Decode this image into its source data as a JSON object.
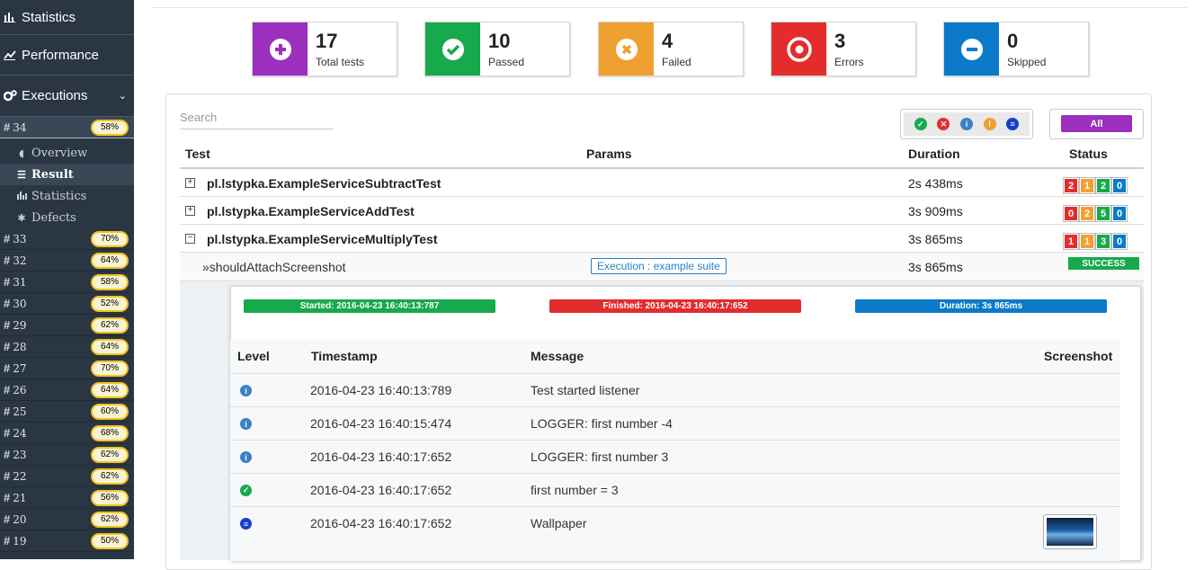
{
  "sidebar": {
    "nav": [
      {
        "label": "Statistics",
        "icon": "bar-chart-icon"
      },
      {
        "label": "Performance",
        "icon": "line-chart-icon"
      },
      {
        "label": "Executions",
        "icon": "gears-icon"
      }
    ],
    "current_run": {
      "hash": "#",
      "num": "34",
      "pct": "58%"
    },
    "sub_items": [
      {
        "label": "Overview",
        "icon": "dashboard-icon"
      },
      {
        "label": "Result",
        "icon": "list-icon"
      },
      {
        "label": "Statistics",
        "icon": "bar-chart-icon"
      },
      {
        "label": "Defects",
        "icon": "bug-icon"
      }
    ],
    "runs": [
      {
        "num": "33",
        "pct": "70%"
      },
      {
        "num": "32",
        "pct": "64%"
      },
      {
        "num": "31",
        "pct": "58%"
      },
      {
        "num": "30",
        "pct": "52%"
      },
      {
        "num": "29",
        "pct": "62%"
      },
      {
        "num": "28",
        "pct": "64%"
      },
      {
        "num": "27",
        "pct": "70%"
      },
      {
        "num": "26",
        "pct": "64%"
      },
      {
        "num": "25",
        "pct": "60%"
      },
      {
        "num": "24",
        "pct": "68%"
      },
      {
        "num": "23",
        "pct": "62%"
      },
      {
        "num": "22",
        "pct": "62%"
      },
      {
        "num": "21",
        "pct": "56%"
      },
      {
        "num": "20",
        "pct": "62%"
      },
      {
        "num": "19",
        "pct": "50%"
      }
    ]
  },
  "stats": [
    {
      "value": "17",
      "label": "Total tests",
      "color": "#9b2fbe",
      "icon": "plus-icon"
    },
    {
      "value": "10",
      "label": "Passed",
      "color": "#17a94b",
      "icon": "check-icon"
    },
    {
      "value": "4",
      "label": "Failed",
      "color": "#f0a030",
      "icon": "times-icon"
    },
    {
      "value": "3",
      "label": "Errors",
      "color": "#e32d2d",
      "icon": "target-icon"
    },
    {
      "value": "0",
      "label": "Skipped",
      "color": "#0b7ac8",
      "icon": "minus-icon"
    }
  ],
  "search": {
    "placeholder": "Search"
  },
  "filter_all_label": "All",
  "table": {
    "headers": {
      "test": "Test",
      "params": "Params",
      "duration": "Duration",
      "status": "Status"
    },
    "rows": [
      {
        "name": "pl.lstypka.ExampleServiceSubtractTest",
        "duration": "2s 438ms",
        "counts": [
          "2",
          "1",
          "2",
          "0"
        ],
        "expand": "+"
      },
      {
        "name": "pl.lstypka.ExampleServiceAddTest",
        "duration": "3s 909ms",
        "counts": [
          "0",
          "2",
          "5",
          "0"
        ],
        "expand": "+"
      },
      {
        "name": "pl.lstypka.ExampleServiceMultiplyTest",
        "duration": "3s 865ms",
        "counts": [
          "1",
          "1",
          "3",
          "0"
        ],
        "expand": "−"
      }
    ],
    "method": {
      "name": "»shouldAttachScreenshot",
      "params": "Execution : example suite",
      "duration": "3s 865ms",
      "status": "SUCCESS"
    }
  },
  "detail": {
    "started": "Started: 2016-04-23 16:40:13:787",
    "finished": "Finished: 2016-04-23 16:40:17:652",
    "duration": "Duration: 3s 865ms",
    "headers": {
      "level": "Level",
      "timestamp": "Timestamp",
      "message": "Message",
      "screenshot": "Screenshot"
    },
    "logs": [
      {
        "level": "info",
        "timestamp": "2016-04-23 16:40:13:789",
        "message": "Test started listener"
      },
      {
        "level": "info",
        "timestamp": "2016-04-23 16:40:15:474",
        "message": "LOGGER: first number -4"
      },
      {
        "level": "info",
        "timestamp": "2016-04-23 16:40:17:652",
        "message": "LOGGER: first number 3"
      },
      {
        "level": "success",
        "timestamp": "2016-04-23 16:40:17:652",
        "message": "first number = 3"
      },
      {
        "level": "screenshot",
        "timestamp": "2016-04-23 16:40:17:652",
        "message": "Wallpaper"
      }
    ]
  }
}
